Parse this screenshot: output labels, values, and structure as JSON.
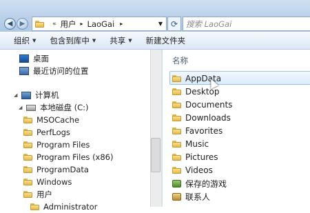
{
  "address": {
    "path": [
      "用户",
      "LaoGai"
    ],
    "search_placeholder": "搜索 LaoGai"
  },
  "toolbar": {
    "organize": "组织",
    "include_library": "包含到库中",
    "share": "共享",
    "new_folder": "新建文件夹"
  },
  "nav_pane": {
    "favorites": [
      {
        "label": "桌面"
      },
      {
        "label": "最近访问的位置"
      }
    ],
    "computer": "计算机",
    "local_disk": "本地磁盘 (C:)",
    "folders": [
      "MSOCache",
      "PerfLogs",
      "Program Files",
      "Program Files (x86)",
      "ProgramData",
      "Windows",
      "用户",
      "Administrator"
    ]
  },
  "content": {
    "column_name": "名称",
    "items": [
      "AppData",
      "Desktop",
      "Documents",
      "Downloads",
      "Favorites",
      "Music",
      "Pictures",
      "Videos",
      "保存的游戏",
      "联系人"
    ],
    "selected_item": "AppData"
  },
  "colors": {
    "accent": "#3a6ea5",
    "selection": "#dcebfb",
    "folder": "#f1c75a"
  }
}
